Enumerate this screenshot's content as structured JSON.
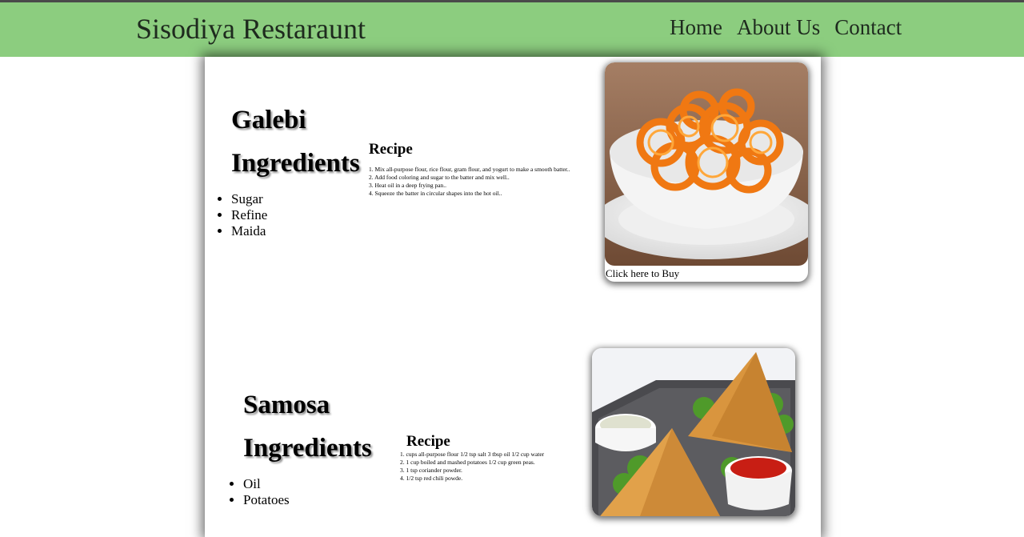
{
  "header": {
    "brand": "Sisodiya Restaraunt",
    "nav": [
      "Home",
      "About Us",
      "Contact"
    ],
    "background": "#8ccd7f"
  },
  "items": [
    {
      "name": "Galebi",
      "ingredients_heading": "Ingredients",
      "ingredients": [
        "Sugar",
        "Refine",
        "Maida"
      ],
      "recipe_heading": "Recipe",
      "steps": [
        "1. Mix all-purpose flour, rice flour, gram flour, and yogurt to make a smooth batter..",
        "2. Add food coloring and sugar to the batter and mix well..",
        "3. Heat oil in a deep frying pan..",
        "4. Squeeze the batter in circular shapes into the hot oil.."
      ],
      "image": "jalebi-photo",
      "buy_label": "Click here to Buy"
    },
    {
      "name": "Samosa",
      "ingredients_heading": "Ingredients",
      "ingredients": [
        "Oil",
        "Potatoes"
      ],
      "recipe_heading": "Recipe",
      "steps": [
        "1. cups all-purpose flour 1/2 tsp salt 3 tbsp oil 1/2 cup water",
        "2. 1 cup boiled and mashed potatoes 1/2 cup green peas.",
        "3. 1 tsp coriander powder.",
        "4. 1/2 tsp red chili powde."
      ],
      "image": "samosa-photo"
    }
  ]
}
